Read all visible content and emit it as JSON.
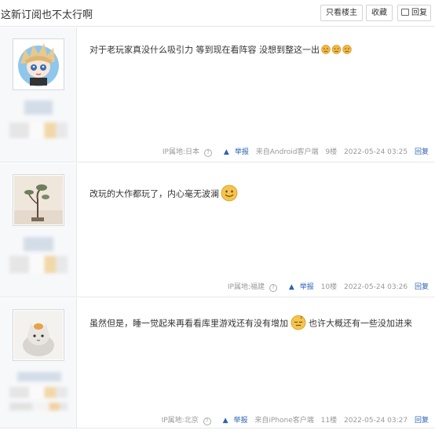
{
  "thread": {
    "title": "这新订阅也不太行啊"
  },
  "toolbar": {
    "only_op": "只看楼主",
    "favorite": "收藏",
    "reply": "回复"
  },
  "posts": [
    {
      "content": "对于老玩家真没什么吸引力 等到现在看阵容 没想到整这一出",
      "ip_label": "IP属地:日本",
      "report": "举报",
      "client": "来自Android客户端",
      "floor": "9楼",
      "time": "2022-05-24 03:25",
      "reply": "回复"
    },
    {
      "content": "改玩的大作都玩了，内心毫无波澜",
      "ip_label": "IP属地:福建",
      "report": "举报",
      "client": "",
      "floor": "10楼",
      "time": "2022-05-24 03:26",
      "reply": "回复"
    },
    {
      "content": "虽然但是，睡一觉起来再看看库里游戏还有没有增加",
      "content_after": "也许大概还有一些没加进来",
      "ip_label": "IP属地:北京",
      "report": "举报",
      "client": "来自iPhone客户端",
      "floor": "11楼",
      "time": "2022-05-24 03:27",
      "reply": "回复"
    }
  ],
  "icons": {
    "question": "question-circle-icon",
    "warning": "warning-triangle-icon"
  },
  "colors": {
    "link": "#2d64b3",
    "meta": "#999999",
    "sidebar": "#f7f8fa"
  }
}
